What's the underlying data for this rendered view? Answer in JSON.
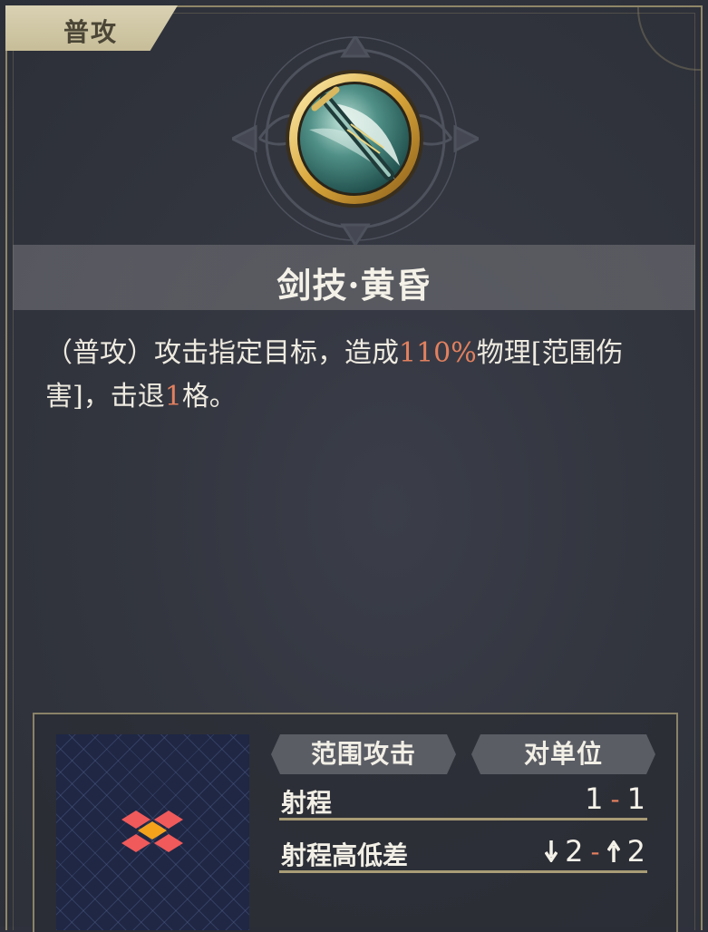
{
  "tag": {
    "label": "普攻"
  },
  "skill": {
    "name": "剑技·黄昏",
    "icon": "sword-slash-icon"
  },
  "description": {
    "p1": "（普攻）攻击指定目标，造成",
    "pct": "110%",
    "p2": "物理[范围伤害]，击退",
    "knockback": "1",
    "p3": "格。"
  },
  "chips": {
    "area": "范围攻击",
    "target": "对单位"
  },
  "stats": {
    "range_label": "射程",
    "range_min": "1",
    "range_sep": "-",
    "range_max": "1",
    "height_label": "射程高低差",
    "height_down_icon": "arrow-down-icon",
    "height_down": "2",
    "height_sep": "-",
    "height_up_icon": "arrow-up-icon",
    "height_up": "2"
  },
  "colors": {
    "highlight": "#e3805f",
    "range_tile": "#f05a5a",
    "center_tile": "#f4a21c",
    "frame_gold": "#8f8668"
  }
}
